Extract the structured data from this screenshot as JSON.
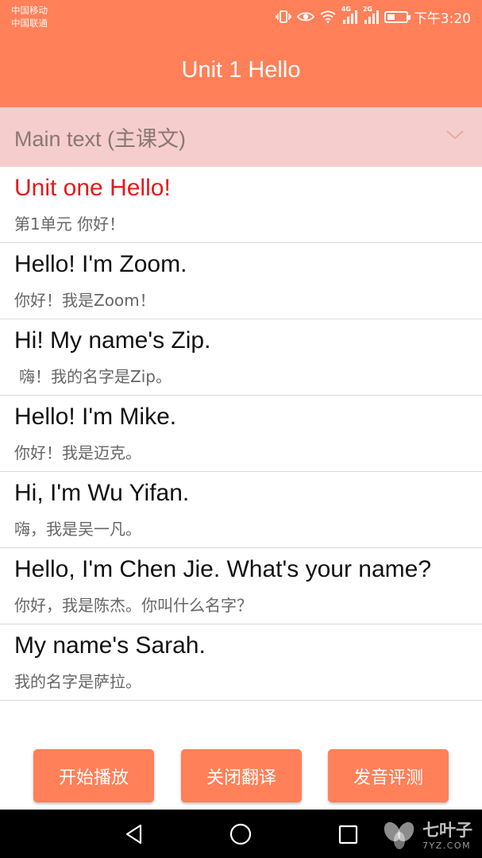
{
  "status_bar": {
    "carrier_1": "中国移动",
    "carrier_2": "中国联通",
    "network_tag_1": "4G",
    "network_tag_2": "2G",
    "time": "下午3:20",
    "icons": [
      "vibrate-icon",
      "eye-icon",
      "wifi-icon",
      "signal-icon",
      "signal-icon",
      "battery-icon"
    ]
  },
  "header": {
    "title": "Unit 1 Hello"
  },
  "section_select": {
    "label": "Main text (主课文)",
    "icon": "chevron-down-icon"
  },
  "sentences": [
    {
      "en": "Unit one Hello!",
      "zh": "第1单元 你好！"
    },
    {
      "en": "Hello! I'm Zoom.",
      "zh": "你好！我是Zoom！"
    },
    {
      "en": "Hi! My name's Zip.",
      "zh": "嗨！我的名字是Zip。"
    },
    {
      "en": "Hello! I'm Mike.",
      "zh": "你好！我是迈克。"
    },
    {
      "en": "Hi, I'm Wu Yifan.",
      "zh": "嗨，我是吴一凡。"
    },
    {
      "en": "Hello, I'm Chen Jie. What's your name?",
      "zh": "你好，我是陈杰。你叫什么名字？"
    },
    {
      "en": "My name's Sarah.",
      "zh": "我的名字是萨拉。"
    }
  ],
  "buttons": {
    "play": "开始播放",
    "translate": "关闭翻译",
    "evaluate": "发音评测"
  },
  "nav": {
    "icons": [
      "back-icon",
      "home-icon",
      "recents-icon"
    ]
  },
  "watermark": {
    "text_cn": "七叶子",
    "text_en": "7YZ.COM"
  },
  "colors": {
    "primary": "#ff8059",
    "section_bg": "#f5cdcd",
    "highlight_text": "#e3191a"
  }
}
